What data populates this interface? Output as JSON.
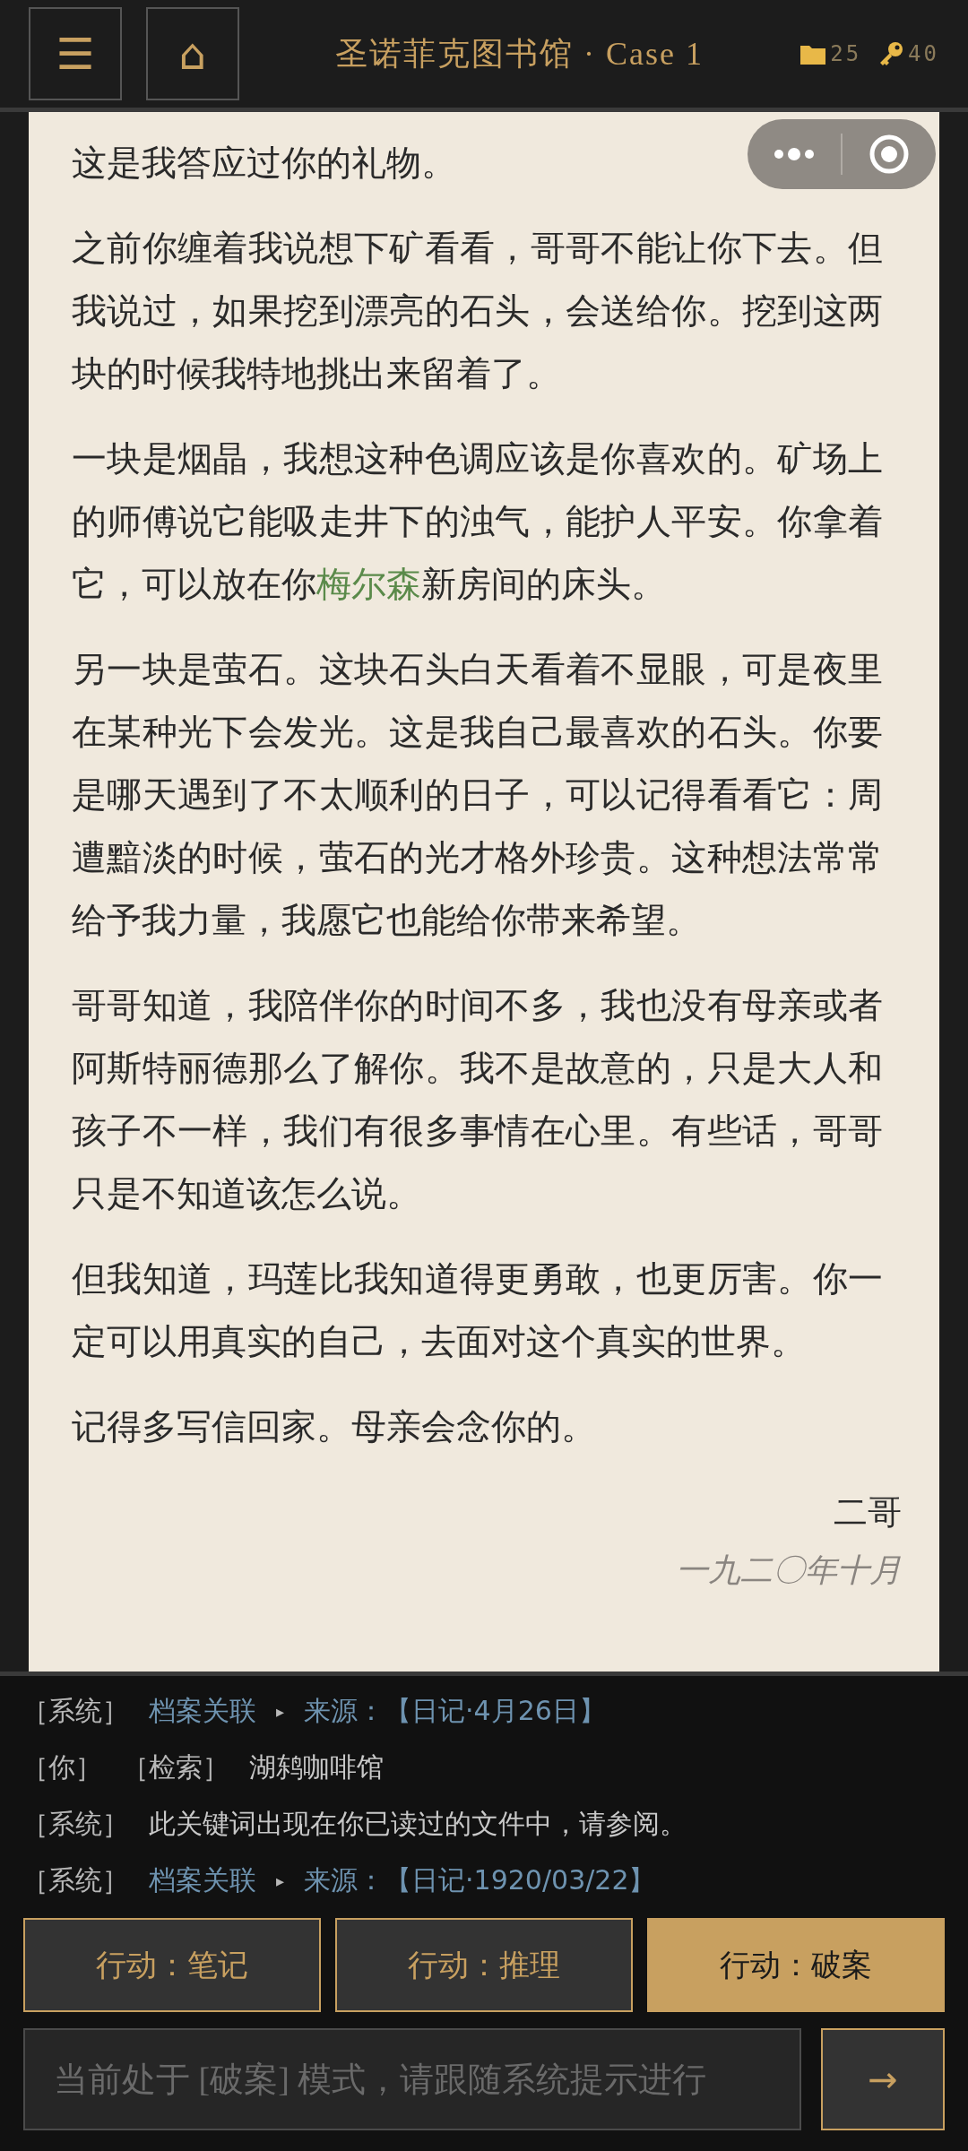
{
  "header": {
    "title": "圣诺菲克图书馆 · Case 1",
    "menu_icon": "☰",
    "home_icon": "⌂",
    "stats": [
      {
        "kind": "folder",
        "value": "25"
      },
      {
        "kind": "key",
        "value": "40"
      }
    ]
  },
  "letter": {
    "paragraphs": [
      [
        {
          "kind": "plain",
          "text": "这是我答应过你的礼物。"
        }
      ],
      [
        {
          "kind": "plain",
          "text": "之前你缠着我说想下矿看看，哥哥不能让你下去。但我说过，如果挖到漂亮的石头，会送给你。挖到这两块的时候我特地挑出来留着了。"
        }
      ],
      [
        {
          "kind": "plain",
          "text": "一块是烟晶，我想这种色调应该是你喜欢的。矿场上的师傅说它能吸走井下的浊气，能护人平安。你拿着它，可以放在你"
        },
        {
          "kind": "name",
          "text": "梅尔森"
        },
        {
          "kind": "plain",
          "text": "新房间的床头。"
        }
      ],
      [
        {
          "kind": "plain",
          "text": "另一块是萤石。这块石头白天看着不显眼，可是夜里在某种光下会发光。这是我自己最喜欢的石头。你要是哪天遇到了不太顺利的日子，可以记得看看它：周遭黯淡的时候，萤石的光才格外珍贵。这种想法常常给予我力量，我愿它也能给你带来希望。"
        }
      ],
      [
        {
          "kind": "plain",
          "text": "哥哥知道，我陪伴你的时间不多，我也没有母亲或者阿斯特丽德那么了解你。我不是故意的，只是大人和孩子不一样，我们有很多事情在心里。有些话，哥哥只是不知道该怎么说。"
        }
      ],
      [
        {
          "kind": "plain",
          "text": "但我知道，玛莲比我知道得更勇敢，也更厉害。你一定可以用真实的自己，去面对这个真实的世界。"
        }
      ],
      [
        {
          "kind": "plain",
          "text": "记得多写信回家。母亲会念你的。"
        }
      ]
    ],
    "signature": "二哥",
    "date": "一九二〇年十月"
  },
  "log": [
    [
      {
        "kind": "tag",
        "text": "［系统］"
      },
      {
        "kind": "link",
        "text": "档案关联"
      },
      {
        "kind": "arrow",
        "text": "▸"
      },
      {
        "kind": "link",
        "text": "来源：【日记·4月26日】"
      }
    ],
    [
      {
        "kind": "tag",
        "text": "［你］"
      },
      {
        "kind": "tag",
        "text": "［检索］"
      },
      {
        "kind": "plain",
        "text": "湖鸫咖啡馆"
      }
    ],
    [
      {
        "kind": "tag",
        "text": "［系统］"
      },
      {
        "kind": "plain",
        "text": "此关键词出现在你已读过的文件中，请参阅。"
      }
    ],
    [
      {
        "kind": "tag",
        "text": "［系统］"
      },
      {
        "kind": "link",
        "text": "档案关联"
      },
      {
        "kind": "arrow",
        "text": "▸"
      },
      {
        "kind": "link",
        "text": "来源：【日记·1920/03/22】"
      }
    ]
  ],
  "actions": [
    {
      "label": "行动：笔记",
      "selected": false
    },
    {
      "label": "行动：推理",
      "selected": false
    },
    {
      "label": "行动：破案",
      "selected": true
    }
  ],
  "input": {
    "placeholder": "当前处于 [破案] 模式，请跟随系统提示进行"
  },
  "send": "→"
}
